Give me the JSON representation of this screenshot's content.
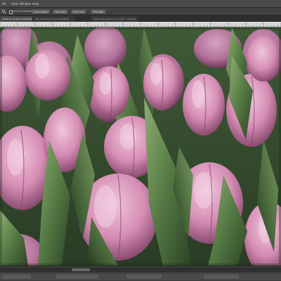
{
  "menubar": {
    "items": [
      "Ps",
      "View",
      "Window",
      "Help"
    ]
  },
  "options_bar": {
    "scroll_all_windows_label": "Scroll All Windows",
    "buttons": [
      "Actual Pixels",
      "Fit Screen",
      "Fill Screen",
      "Print Size"
    ]
  },
  "document": {
    "active_tab": "Untitled-1 @ 66.7% (RGB/8)",
    "other_tabs": [
      "IMG_0012.jpg @ 33.3% (RGB/8)",
      "tulips_pink.psd @ 50% (Layer 1, RGB/8)"
    ]
  },
  "canvas": {
    "subject": "pink tulips",
    "colors": {
      "petal": "#d58db4",
      "petal_light": "#e9b8d0",
      "petal_shadow": "#8f4d74",
      "leaf": "#4d6e3f",
      "leaf_light": "#86a66d",
      "leaf_dark": "#2a3f24"
    }
  },
  "status_bar": {
    "scrollbar": "horizontal-scrollbar"
  },
  "theme": {
    "menubar_bg": "#4a4a4a",
    "panel_bg": "#404040",
    "tab_bg": "#2e2e2e",
    "ruler_bg": "#d6d6d6"
  }
}
